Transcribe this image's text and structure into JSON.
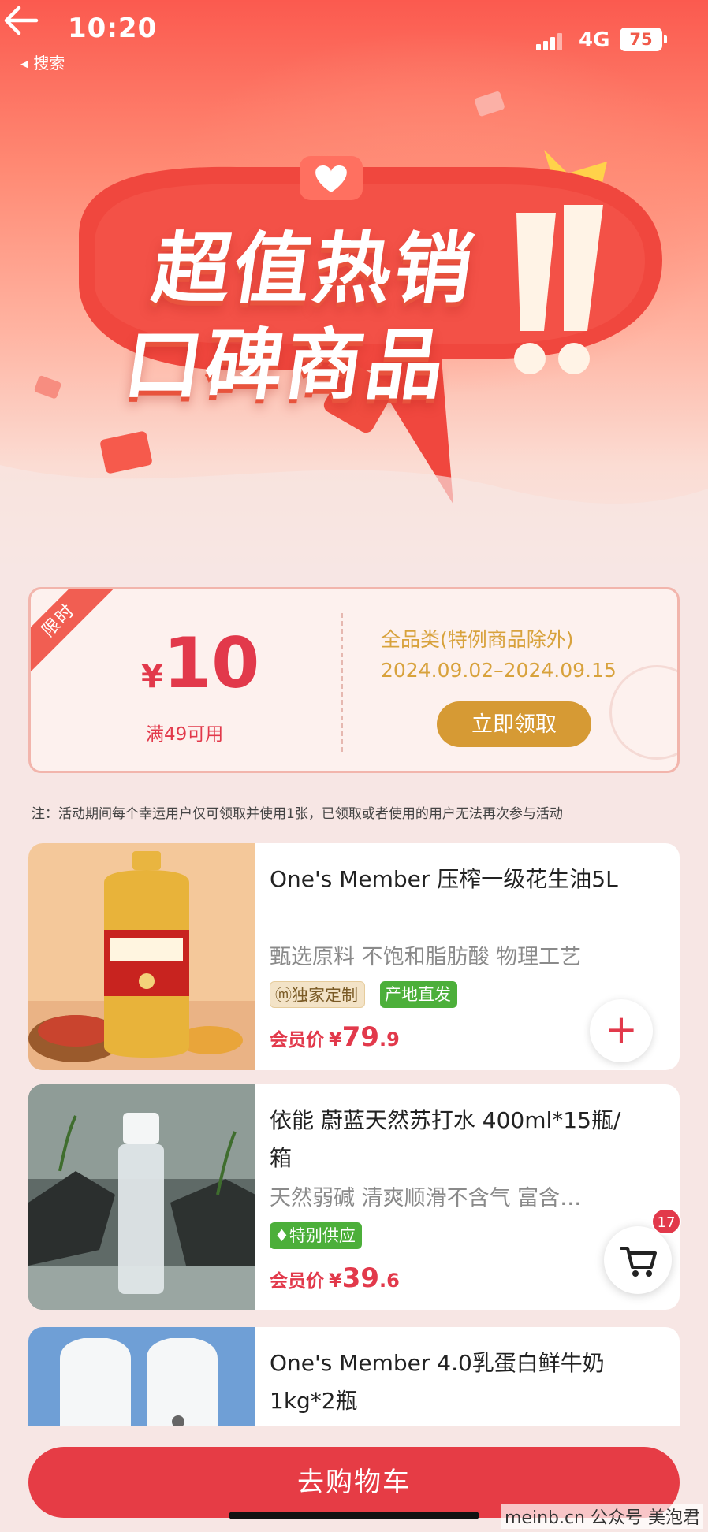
{
  "status_bar": {
    "time": "10:20",
    "back_app": "◂ 搜索",
    "network": "4G",
    "battery": "75"
  },
  "hero": {
    "title_line1": "超值热销",
    "title_line2": "口碑商品"
  },
  "coupon": {
    "ribbon": "限时",
    "currency": "¥",
    "amount": "10",
    "condition": "满49可用",
    "category": "全品类(特例商品除外)",
    "date_range": "2024.09.02–2024.09.15",
    "claim_button": "立即领取"
  },
  "note": "注：活动期间每个幸运用户仅可领取并使用1张，已领取或者使用的用户无法再次参与活动",
  "products": [
    {
      "name": "One's Member 压榨一级花生油5L",
      "desc": "甄选原料 不饱和脂肪酸 物理工艺",
      "tags": [
        "独家定制",
        "产地直发"
      ],
      "price_label": "会员价",
      "currency": "¥",
      "price_int": "79",
      "price_dec": ".9"
    },
    {
      "name": "依能 蔚蓝天然苏打水 400ml*15瓶/箱",
      "desc": "天然弱碱 清爽顺滑不含气 富含多…",
      "tags": [
        "特别供应"
      ],
      "price_label": "会员价",
      "currency": "¥",
      "price_int": "39",
      "price_dec": ".6"
    },
    {
      "name": "One's Member 4.0乳蛋白鲜牛奶1kg*2瓶"
    }
  ],
  "cart": {
    "badge": "17",
    "go_cart_button": "去购物车"
  },
  "watermark": "meinb.cn 公众号 美泡君",
  "colors": {
    "accent": "#e2394b",
    "gold": "#d69a34",
    "hero_red": "#fb5a4f"
  }
}
